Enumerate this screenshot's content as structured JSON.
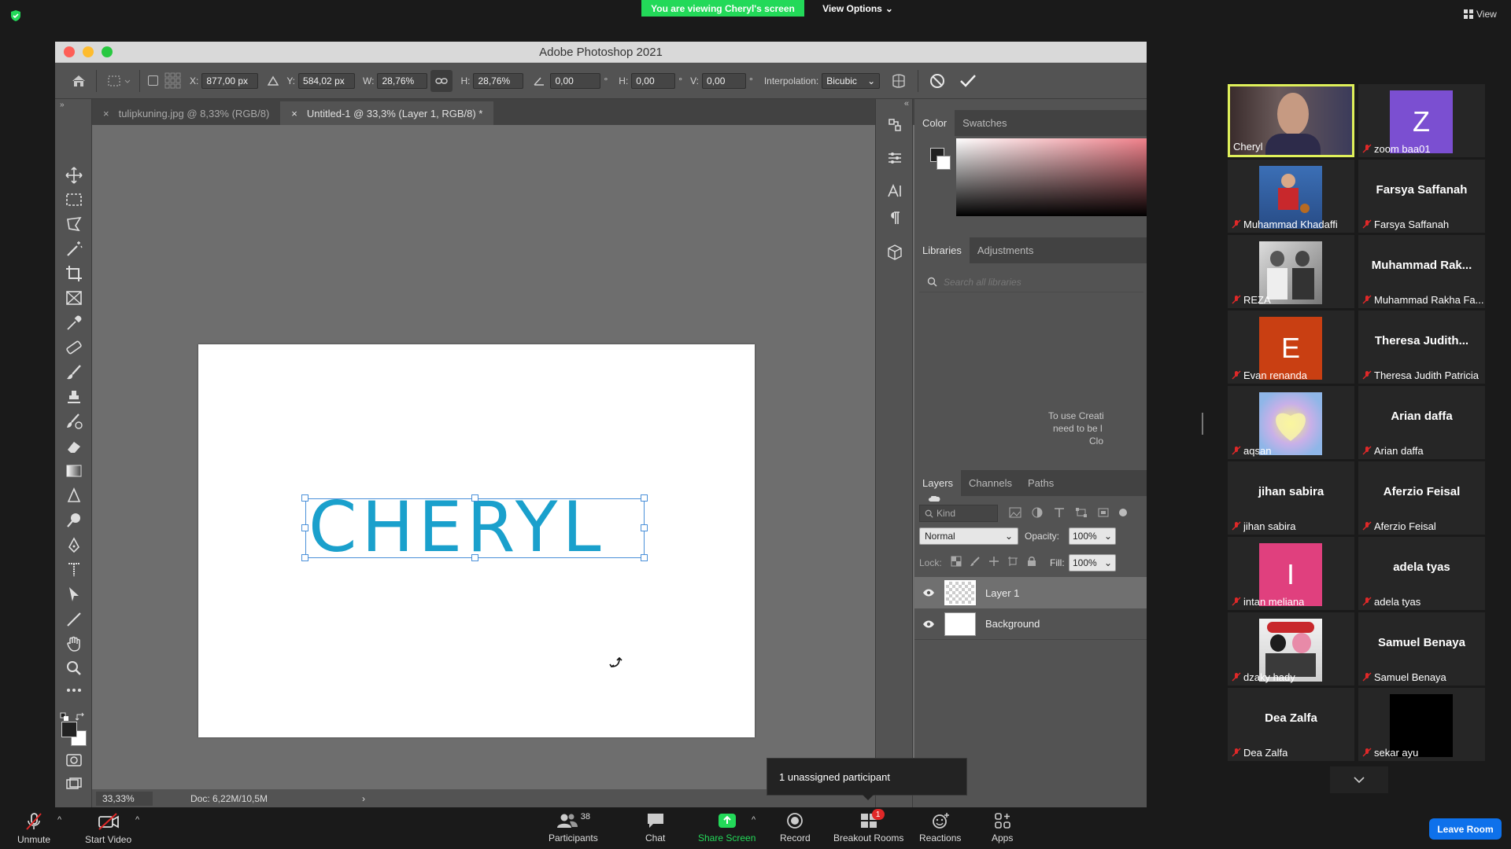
{
  "zoom": {
    "viewing_banner": "You are viewing Cheryl's screen",
    "view_options": "View Options",
    "view_label": "View",
    "unassigned": "1 unassigned participant",
    "leave_room": "Leave Room",
    "toolbar": {
      "unmute": "Unmute",
      "start_video": "Start Video",
      "participants": "Participants",
      "participants_count": "38",
      "chat": "Chat",
      "share_screen": "Share Screen",
      "record": "Record",
      "breakout_rooms": "Breakout Rooms",
      "breakout_badge": "1",
      "reactions": "Reactions",
      "apps": "Apps"
    },
    "participants": [
      {
        "name": "Cheryl",
        "display": "",
        "kind": "video-cheryl"
      },
      {
        "name": "zoom baa01",
        "display": "Z",
        "kind": "avatar",
        "color": "#7b4fd1"
      },
      {
        "name": "Muhammad Khadaffi",
        "display": "",
        "kind": "photo-soccer"
      },
      {
        "name": "Farsya Saffanah",
        "display": "Farsya Saffanah",
        "kind": "text"
      },
      {
        "name": "REZA",
        "display": "",
        "kind": "photo-bw"
      },
      {
        "name": "Muhammad Rakha Fa...",
        "display": "Muhammad  Rak...",
        "kind": "text"
      },
      {
        "name": "Evan renanda",
        "display": "E",
        "kind": "avatar",
        "color": "#c93f12"
      },
      {
        "name": "Theresa Judith Patricia",
        "display": "Theresa  Judith...",
        "kind": "text"
      },
      {
        "name": "aqsan",
        "display": "",
        "kind": "photo-heart"
      },
      {
        "name": "Arian daffa",
        "display": "Arian daffa",
        "kind": "text"
      },
      {
        "name": "jihan sabira",
        "display": "jihan sabira",
        "kind": "text"
      },
      {
        "name": "Aferzio Feisal",
        "display": "Aferzio Feisal",
        "kind": "text"
      },
      {
        "name": "intan meliana",
        "display": "I",
        "kind": "avatar",
        "color": "#e0407e"
      },
      {
        "name": "adela tyas",
        "display": "adela tyas",
        "kind": "text"
      },
      {
        "name": "dzaky hady",
        "display": "",
        "kind": "photo-persija"
      },
      {
        "name": "Samuel Benaya",
        "display": "Samuel Benaya",
        "kind": "text"
      },
      {
        "name": "Dea Zalfa",
        "display": "Dea Zalfa",
        "kind": "text"
      },
      {
        "name": "sekar ayu",
        "display": "",
        "kind": "black"
      }
    ]
  },
  "ps": {
    "title": "Adobe Photoshop 2021",
    "options": {
      "x_label": "X:",
      "x_value": "877,00 px",
      "y_label": "Y:",
      "y_value": "584,02 px",
      "w_label": "W:",
      "w_value": "28,76%",
      "h_label": "H:",
      "h_value": "28,76%",
      "angle_value": "0,00",
      "hskew_label": "H:",
      "hskew_value": "0,00",
      "vskew_label": "V:",
      "vskew_value": "0,00",
      "degree": "°",
      "interp_label": "Interpolation:",
      "interp_value": "Bicubic"
    },
    "tabs": [
      {
        "label": "tulipkuning.jpg @ 8,33% (RGB/8)"
      },
      {
        "label": "Untitled-1 @ 33,3% (Layer 1, RGB/8) *"
      }
    ],
    "canvas_text": "CHERYL",
    "status": {
      "zoom": "33,33%",
      "doc": "Doc: 6,22M/10,5M"
    },
    "panels": {
      "color_tab": "Color",
      "swatches_tab": "Swatches",
      "libraries_tab": "Libraries",
      "adjustments_tab": "Adjustments",
      "search_placeholder": "Search all libraries",
      "lib_msg1": "To use Creati",
      "lib_msg2": "need to be l",
      "lib_msg3": "Clo",
      "layers_tab": "Layers",
      "channels_tab": "Channels",
      "paths_tab": "Paths",
      "kind": "Kind",
      "blend": "Normal",
      "opacity_label": "Opacity:",
      "opacity": "100%",
      "lock_label": "Lock:",
      "fill_label": "Fill:",
      "fill": "100%",
      "layers": [
        {
          "name": "Layer 1"
        },
        {
          "name": "Background"
        }
      ]
    }
  }
}
